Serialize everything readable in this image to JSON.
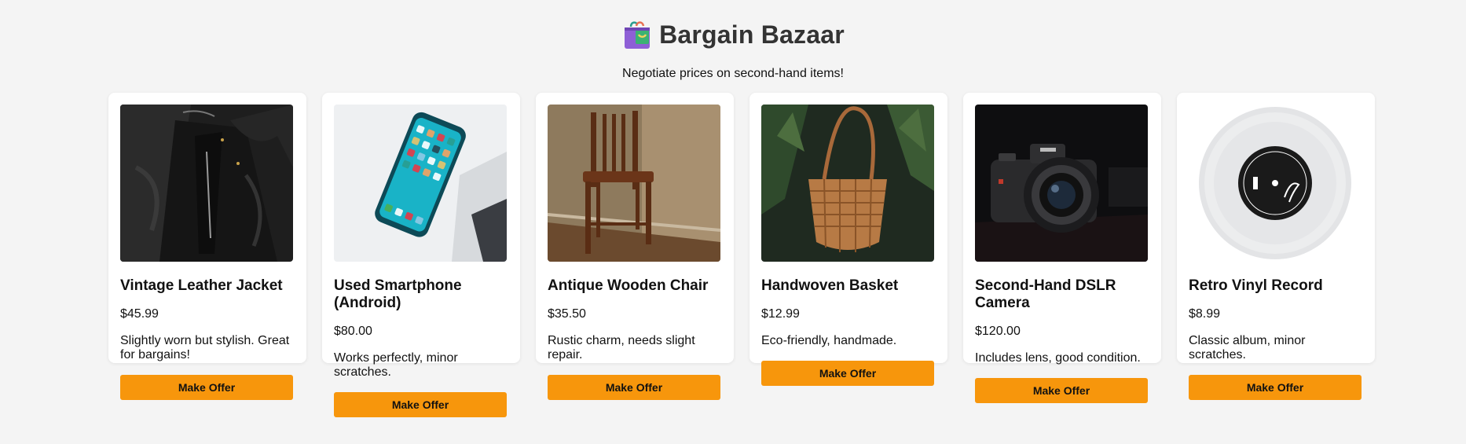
{
  "header": {
    "title": "Bargain Bazaar",
    "subtitle": "Negotiate prices on second-hand items!",
    "icon": "shopping-bag-icon"
  },
  "colors": {
    "background": "#f4f4f4",
    "card": "#ffffff",
    "button": "#f7960c",
    "title": "#333333"
  },
  "products": [
    {
      "name": "Vintage Leather Jacket",
      "price": "$45.99",
      "description": "Slightly worn but stylish. Great for bargains!",
      "button": "Make Offer",
      "image": "leather-jacket-photo"
    },
    {
      "name": "Used Smartphone (Android)",
      "price": "$80.00",
      "description": "Works perfectly, minor scratches.",
      "button": "Make Offer",
      "image": "smartphone-photo"
    },
    {
      "name": "Antique Wooden Chair",
      "price": "$35.50",
      "description": "Rustic charm, needs slight repair.",
      "button": "Make Offer",
      "image": "wooden-chair-photo"
    },
    {
      "name": "Handwoven Basket",
      "price": "$12.99",
      "description": "Eco-friendly, handmade.",
      "button": "Make Offer",
      "image": "basket-photo"
    },
    {
      "name": "Second-Hand DSLR Camera",
      "price": "$120.00",
      "description": "Includes lens, good condition.",
      "button": "Make Offer",
      "image": "camera-photo"
    },
    {
      "name": "Retro Vinyl Record",
      "price": "$8.99",
      "description": "Classic album, minor scratches.",
      "button": "Make Offer",
      "image": "vinyl-record-photo"
    }
  ]
}
